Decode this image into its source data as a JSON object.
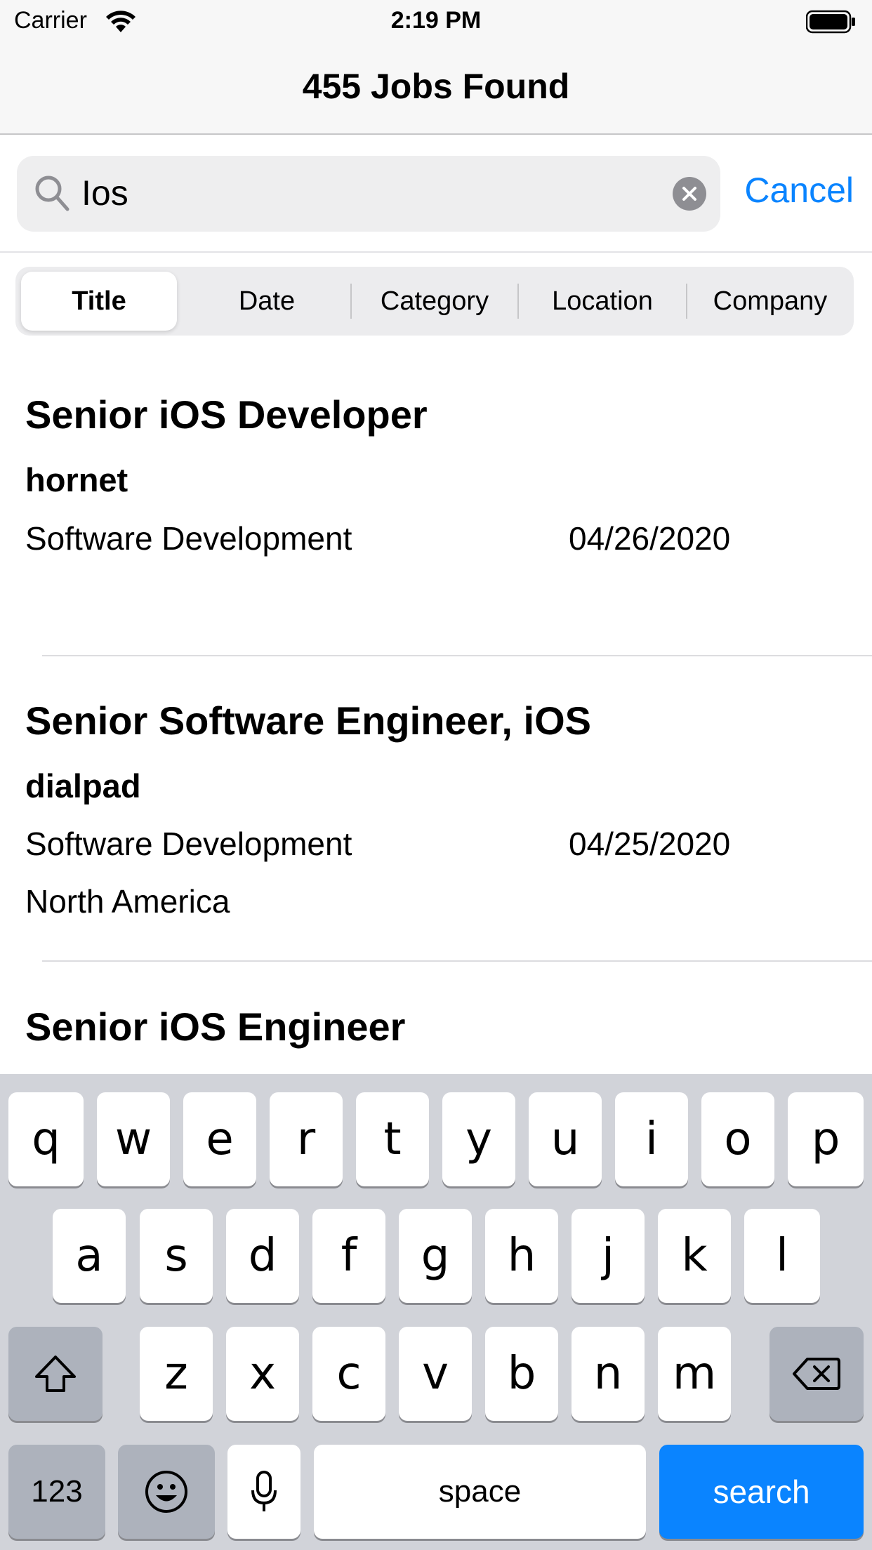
{
  "status": {
    "carrier": "Carrier",
    "time": "2:19 PM"
  },
  "nav": {
    "title": "455 Jobs Found"
  },
  "search": {
    "value": "Ios",
    "cancel_label": "Cancel"
  },
  "segments": [
    "Title",
    "Date",
    "Category",
    "Location",
    "Company"
  ],
  "selected_segment": "Title",
  "jobs": [
    {
      "title": "Senior iOS Developer",
      "company": "hornet",
      "category": "Software Development",
      "date": "04/26/2020",
      "location": ""
    },
    {
      "title": "Senior Software Engineer, iOS",
      "company": "dialpad",
      "category": "Software Development",
      "date": "04/25/2020",
      "location": "North America"
    },
    {
      "title": "Senior iOS Engineer",
      "company": "",
      "category": "",
      "date": "",
      "location": ""
    }
  ],
  "keyboard": {
    "row1": [
      "q",
      "w",
      "e",
      "r",
      "t",
      "y",
      "u",
      "i",
      "o",
      "p"
    ],
    "row2": [
      "a",
      "s",
      "d",
      "f",
      "g",
      "h",
      "j",
      "k",
      "l"
    ],
    "row3": [
      "z",
      "x",
      "c",
      "v",
      "b",
      "n",
      "m"
    ],
    "numbers_label": "123",
    "space_label": "space",
    "search_label": "search",
    "shift_icon": "shift-icon",
    "delete_icon": "backspace-icon",
    "emoji_icon": "emoji-icon",
    "mic_icon": "microphone-icon"
  },
  "colors": {
    "accent": "#0a84ff",
    "keyboard_bg": "#d1d3d9",
    "search_bg": "#eeeeef"
  }
}
